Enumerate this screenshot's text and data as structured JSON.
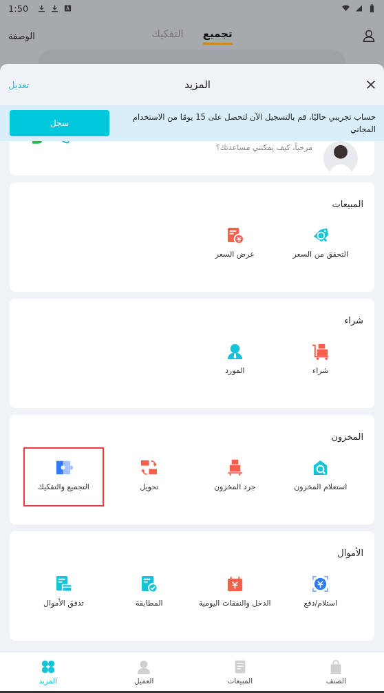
{
  "status_bar": {
    "time": "1:50"
  },
  "top_bar": {
    "left_label": "الوصفة",
    "tabs": [
      {
        "label": "تجميع",
        "selected": true
      },
      {
        "label": "التفكيك",
        "selected": false
      }
    ]
  },
  "sheet": {
    "title": "المزيد",
    "edit_link": "تعديل",
    "banner": {
      "message": "حساب تجريبي حاليًا، قم بالتسجيل الآن لتحصل على 15 يومًا من الاستخدام المجاني",
      "button": "سجل"
    },
    "assistant": {
      "greeting": "مرحباً، كيف يمكنني مساعدتك؟"
    },
    "sections": [
      {
        "title": "المبيعات",
        "items": [
          {
            "label": "التحقق من السعر",
            "highlighted": false
          },
          {
            "label": "عرض السعر",
            "highlighted": false
          }
        ]
      },
      {
        "title": "شراء",
        "items": [
          {
            "label": "شراء",
            "highlighted": false
          },
          {
            "label": "المورد",
            "highlighted": false
          }
        ]
      },
      {
        "title": "المخزون",
        "items": [
          {
            "label": "استعلام المخزون",
            "highlighted": false
          },
          {
            "label": "جرد المخزون",
            "highlighted": false
          },
          {
            "label": "تحويل",
            "highlighted": false
          },
          {
            "label": "التجميع والتفكيك",
            "highlighted": true
          }
        ]
      },
      {
        "title": "الأموال",
        "items": [
          {
            "label": "استلام/دفع",
            "highlighted": false
          },
          {
            "label": "الدخل والنفقات اليومية",
            "highlighted": false
          },
          {
            "label": "المطابقة",
            "highlighted": false
          },
          {
            "label": "تدفق الأموال",
            "highlighted": false
          }
        ]
      }
    ]
  },
  "bottom_nav": [
    {
      "label": "الصنف",
      "selected": false
    },
    {
      "label": "المبيعات",
      "selected": false
    },
    {
      "label": "العميل",
      "selected": false
    },
    {
      "label": "المزيد",
      "selected": true
    }
  ]
}
